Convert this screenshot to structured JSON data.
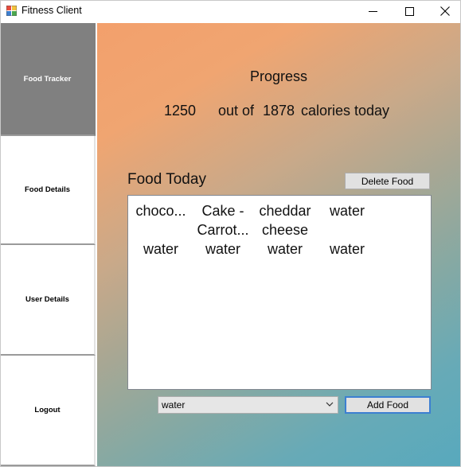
{
  "window": {
    "title": "Fitness Client",
    "controls": {
      "minimize": "minimize-icon",
      "maximize": "maximize-icon",
      "close": "close-icon"
    }
  },
  "sidebar": {
    "items": [
      {
        "label": "Food Tracker",
        "active": true
      },
      {
        "label": "Food Details",
        "active": false
      },
      {
        "label": "User Details",
        "active": false
      },
      {
        "label": "Logout",
        "active": false
      }
    ]
  },
  "progress": {
    "title": "Progress",
    "current": "1250",
    "out_of": "out of",
    "goal": "1878",
    "suffix": "calories today"
  },
  "food_today": {
    "title": "Food Today",
    "delete_label": "Delete Food",
    "items": [
      [
        "choco...",
        ""
      ],
      [
        "Cake -",
        "Carrot..."
      ],
      [
        "cheddar",
        "cheese"
      ],
      [
        "water",
        ""
      ],
      [
        "water",
        ""
      ],
      [
        "water",
        ""
      ],
      [
        "water",
        ""
      ],
      [
        "water",
        ""
      ]
    ]
  },
  "add_food": {
    "selected": "water",
    "add_label": "Add Food"
  },
  "colors": {
    "sidebar_active": "#808080",
    "gradient_start": "#f3a06c",
    "gradient_end": "#58a9bd",
    "button_focus_border": "#3c7fd1"
  }
}
